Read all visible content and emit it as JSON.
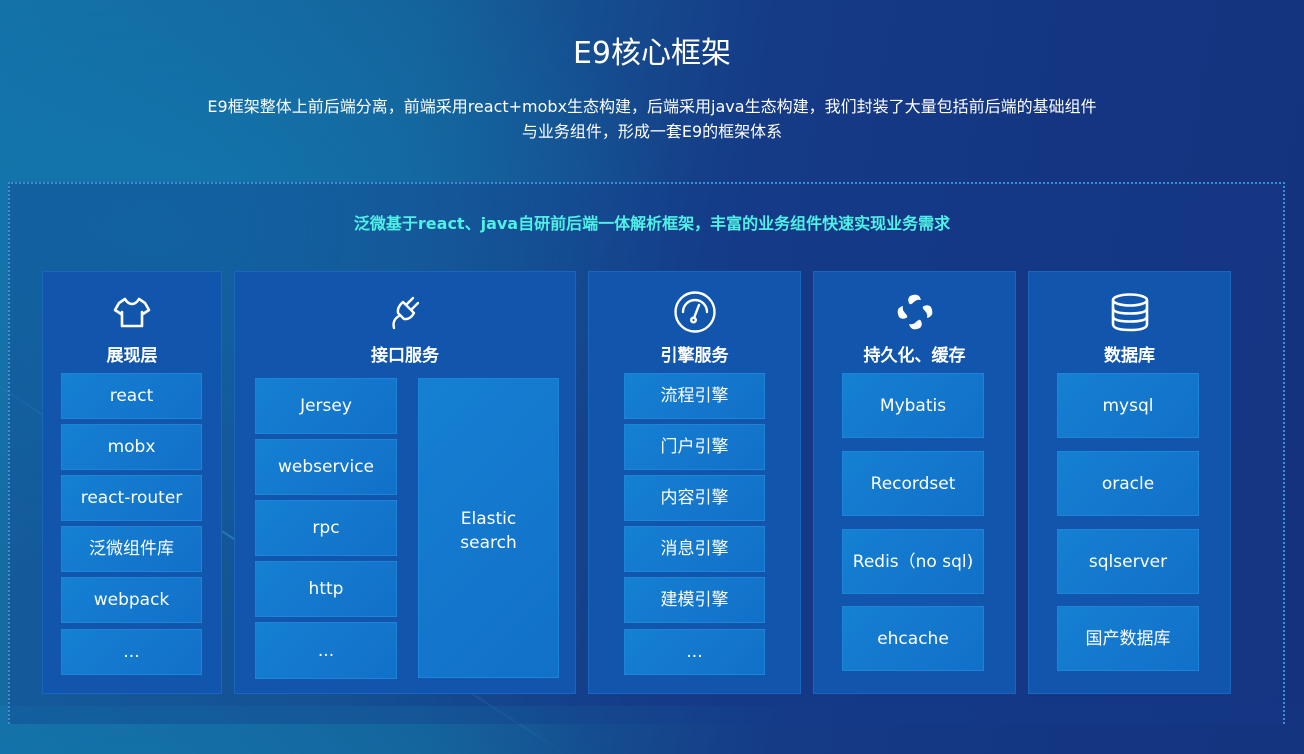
{
  "header": {
    "title": "E9核心框架",
    "description_line1": "E9框架整体上前后端分离，前端采用react+mobx生态构建，后端采用java生态构建，我们封装了大量包括前后端的基础组件",
    "description_line2": "与业务组件，形成一套E9的框架体系"
  },
  "tagline": "泛微基于react、java自研前后端一体解析框架，丰富的业务组件快速实现业务需求",
  "colors": {
    "tagline": "#4ff0e6",
    "column_bg": "#1155ac",
    "cell_bg": "#147ad0"
  },
  "columns": [
    {
      "icon": "tshirt-icon",
      "title": "展现层",
      "items": [
        "react",
        "mobx",
        "react-router",
        "泛微组件库",
        "webpack",
        "..."
      ]
    },
    {
      "icon": "plug-icon",
      "title": "接口服务",
      "items": [
        "Jersey",
        "webservice",
        "rpc",
        "http",
        "..."
      ],
      "side_item": "Elastic\nsearch"
    },
    {
      "icon": "gauge-icon",
      "title": "引擎服务",
      "items": [
        "流程引擎",
        "门户引擎",
        "内容引擎",
        "消息引擎",
        "建模引擎",
        "..."
      ]
    },
    {
      "icon": "pinwheel-icon",
      "title": "持久化、缓存",
      "items": [
        "Mybatis",
        "Recordset",
        "Redis（no sql)",
        "ehcache"
      ]
    },
    {
      "icon": "database-icon",
      "title": "数据库",
      "items": [
        "mysql",
        "oracle",
        "sqlserver",
        "国产数据库"
      ]
    }
  ]
}
